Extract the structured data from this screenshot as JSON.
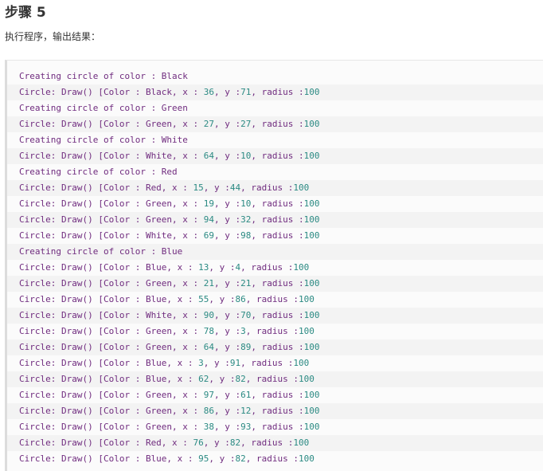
{
  "page": {
    "step_title": "步骤 5",
    "intro": "执行程序，输出结果："
  },
  "output_lines": [
    "Creating circle of color : Black",
    "Circle: Draw() [Color : Black, x : 36, y :71, radius :100",
    "Creating circle of color : Green",
    "Circle: Draw() [Color : Green, x : 27, y :27, radius :100",
    "Creating circle of color : White",
    "Circle: Draw() [Color : White, x : 64, y :10, radius :100",
    "Creating circle of color : Red",
    "Circle: Draw() [Color : Red, x : 15, y :44, radius :100",
    "Circle: Draw() [Color : Green, x : 19, y :10, radius :100",
    "Circle: Draw() [Color : Green, x : 94, y :32, radius :100",
    "Circle: Draw() [Color : White, x : 69, y :98, radius :100",
    "Creating circle of color : Blue",
    "Circle: Draw() [Color : Blue, x : 13, y :4, radius :100",
    "Circle: Draw() [Color : Green, x : 21, y :21, radius :100",
    "Circle: Draw() [Color : Blue, x : 55, y :86, radius :100",
    "Circle: Draw() [Color : White, x : 90, y :70, radius :100",
    "Circle: Draw() [Color : Green, x : 78, y :3, radius :100",
    "Circle: Draw() [Color : Green, x : 64, y :89, radius :100",
    "Circle: Draw() [Color : Blue, x : 3, y :91, radius :100",
    "Circle: Draw() [Color : Blue, x : 62, y :82, radius :100",
    "Circle: Draw() [Color : Green, x : 97, y :61, radius :100",
    "Circle: Draw() [Color : Green, x : 86, y :12, radius :100",
    "Circle: Draw() [Color : Green, x : 38, y :93, radius :100",
    "Circle: Draw() [Color : Red, x : 76, y :82, radius :100",
    "Circle: Draw() [Color : Blue, x : 95, y :82, radius :100"
  ],
  "colors": {
    "text": "#702c7f",
    "number": "#2b8a83",
    "heading": "#333333"
  }
}
